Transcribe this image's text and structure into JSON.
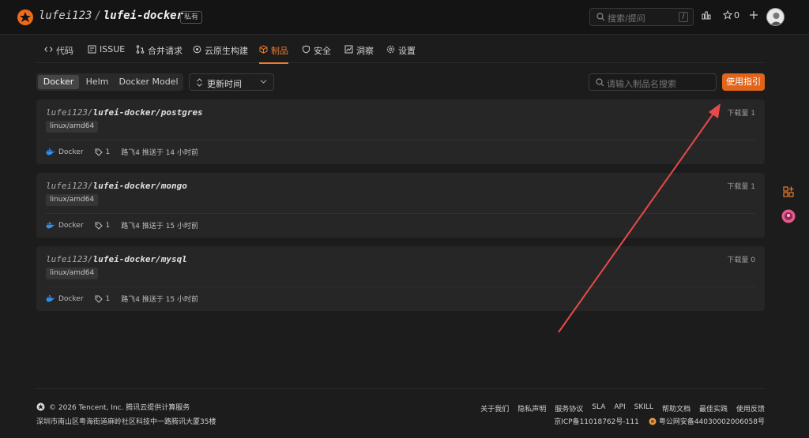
{
  "header": {
    "owner": "lufei123",
    "separator": "/",
    "repo": "lufei-docker",
    "visibility": "私有",
    "search_placeholder": "搜索/提问",
    "search_key": "/",
    "star_count": "0"
  },
  "tabs": [
    {
      "label": "代码",
      "icon": "code-icon"
    },
    {
      "label": "ISSUE",
      "icon": "issue-icon"
    },
    {
      "label": "合并请求",
      "icon": "pull-request-icon"
    },
    {
      "label": "云原生构建",
      "icon": "build-icon"
    },
    {
      "label": "制品",
      "icon": "package-icon",
      "active": true
    },
    {
      "label": "安全",
      "icon": "shield-icon"
    },
    {
      "label": "洞察",
      "icon": "insight-icon"
    },
    {
      "label": "设置",
      "icon": "gear-icon"
    }
  ],
  "filters": {
    "types": [
      "Docker",
      "Helm",
      "Docker Model"
    ],
    "active_type": "Docker",
    "sort_label": "更新时间",
    "search_placeholder": "请输入制品名搜索",
    "guide_button": "使用指引"
  },
  "artifacts": [
    {
      "owner": "lufei123/",
      "path": "lufei-docker/postgres",
      "platform": "linux/amd64",
      "type": "Docker",
      "tags": "1",
      "pushed": "路飞4 推送于 14 小时前",
      "downloads": "下载量 1"
    },
    {
      "owner": "lufei123/",
      "path": "lufei-docker/mongo",
      "platform": "linux/amd64",
      "type": "Docker",
      "tags": "1",
      "pushed": "路飞4 推送于 15 小时前",
      "downloads": "下载量 1"
    },
    {
      "owner": "lufei123/",
      "path": "lufei-docker/mysql",
      "platform": "linux/amd64",
      "type": "Docker",
      "tags": "1",
      "pushed": "路飞4 推送于 15 小时前",
      "downloads": "下载量 0"
    }
  ],
  "footer": {
    "copyright": "© 2026 Tencent, Inc. 腾讯云提供计算服务",
    "address": "深圳市南山区粤海街道麻岭社区科技中一路腾讯大厦35楼",
    "links": [
      "关于我们",
      "隐私声明",
      "服务协议",
      "SLA",
      "API",
      "SKILL",
      "帮助文档",
      "最佳实践",
      "使用反馈"
    ],
    "icp": "京ICP备11018762号-111",
    "police": "粤公网安备44030002006058号"
  },
  "colors": {
    "accent": "#ee7c2c",
    "button": "#e0641a",
    "annotation_arrow": "#e84a4a"
  }
}
